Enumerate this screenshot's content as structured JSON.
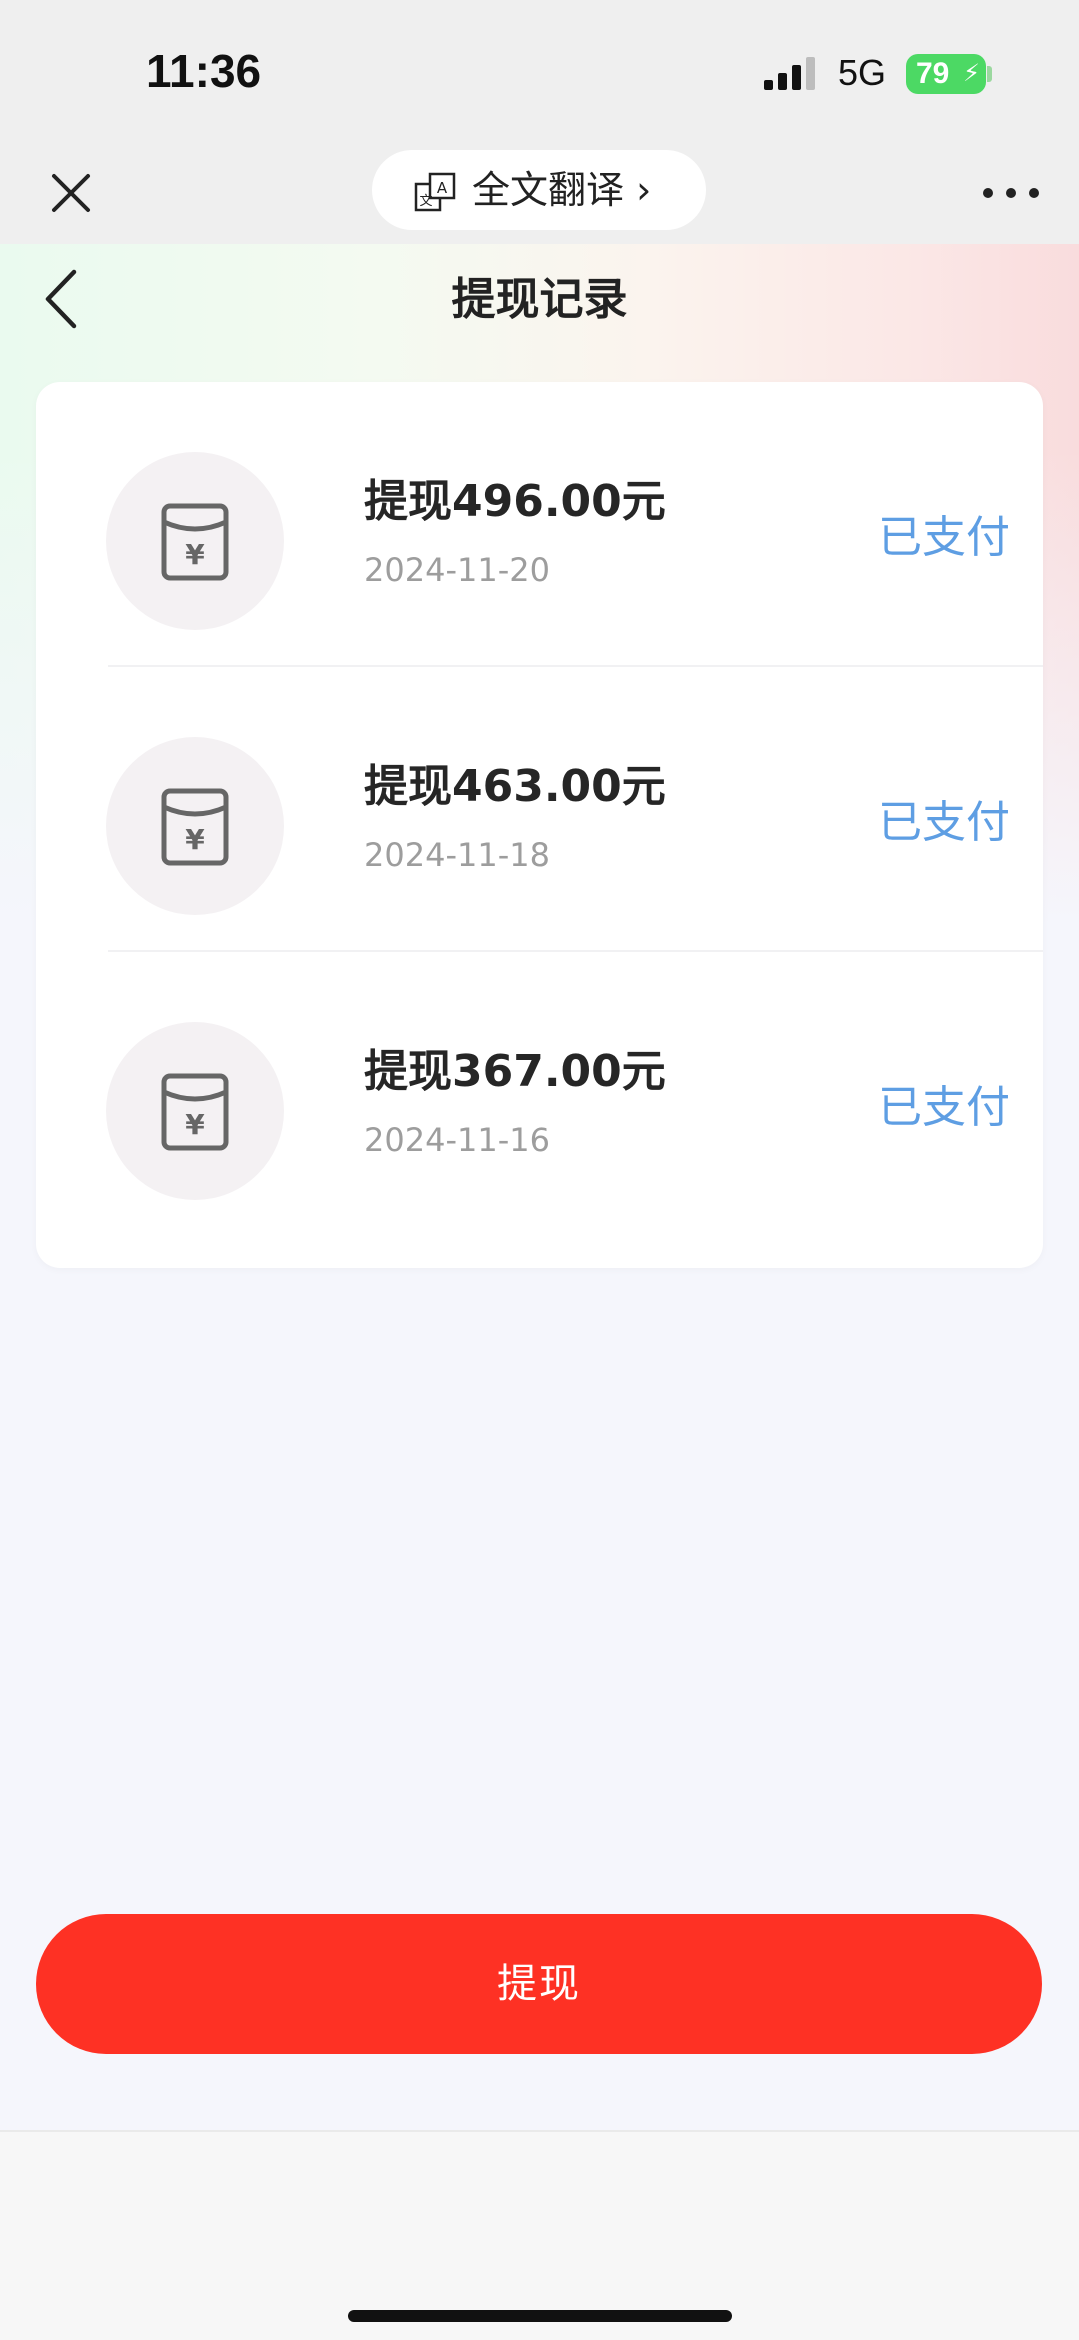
{
  "status_bar": {
    "time": "11:36",
    "network": "5G",
    "battery": "79"
  },
  "browser_bar": {
    "translate_label": "全文翻译 ›"
  },
  "header": {
    "title": "提现记录"
  },
  "records": [
    {
      "amount": "提现496.00元",
      "date": "2024-11-20",
      "status": "已支付"
    },
    {
      "amount": "提现463.00元",
      "date": "2024-11-18",
      "status": "已支付"
    },
    {
      "amount": "提现367.00元",
      "date": "2024-11-16",
      "status": "已支付"
    }
  ],
  "withdraw_button": {
    "label": "提现"
  },
  "colors": {
    "accent_red": "#fe3124",
    "status_blue": "#5e9ee3",
    "battery_green": "#4cd964"
  }
}
